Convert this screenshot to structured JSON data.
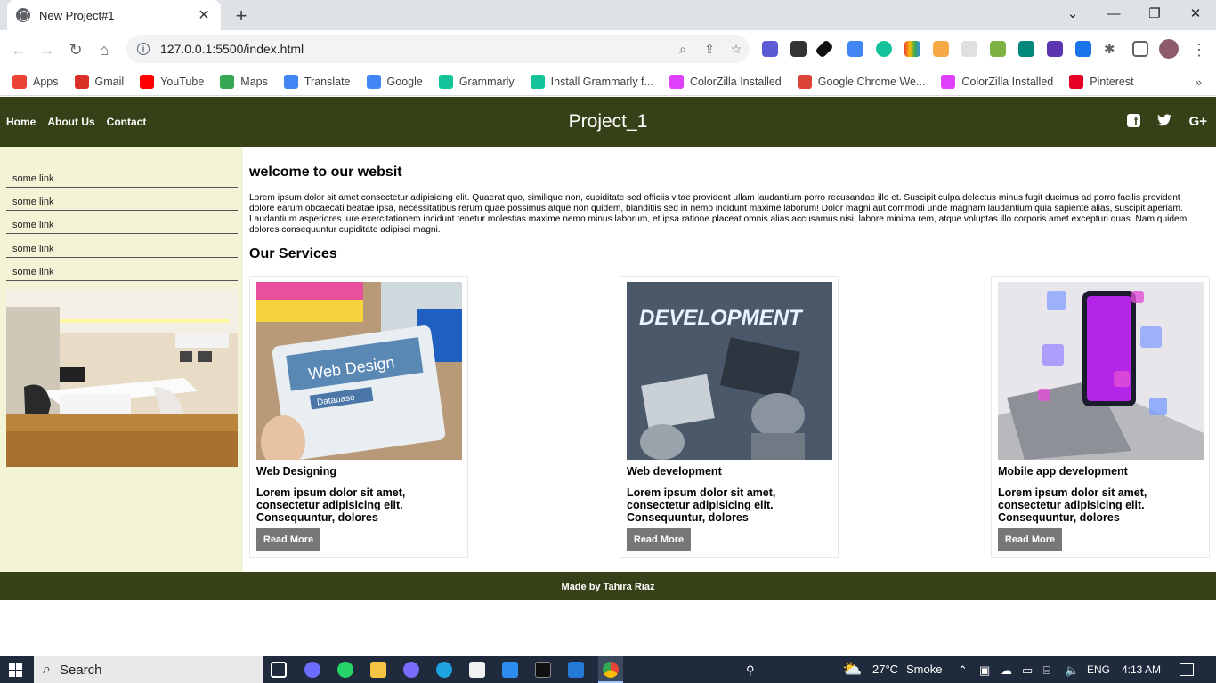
{
  "browser": {
    "tab_title": "New Project#1",
    "tab_close": "✕",
    "new_tab": "+",
    "url": "127.0.0.1:5500/index.html",
    "bookmarks": [
      {
        "label": "Apps",
        "icon": "apps-grid-icon",
        "color": "#ea4335"
      },
      {
        "label": "Gmail",
        "icon": "gmail-icon",
        "color": "#d93025"
      },
      {
        "label": "YouTube",
        "icon": "youtube-icon",
        "color": "#ff0000"
      },
      {
        "label": "Maps",
        "icon": "maps-pin-icon",
        "color": "#34a853"
      },
      {
        "label": "Translate",
        "icon": "translate-icon",
        "color": "#4285f4"
      },
      {
        "label": "Google",
        "icon": "google-icon",
        "color": "#4285f4"
      },
      {
        "label": "Grammarly",
        "icon": "grammarly-icon",
        "color": "#15c39a"
      },
      {
        "label": "Install Grammarly f...",
        "icon": "grammarly-icon",
        "color": "#15c39a"
      },
      {
        "label": "ColorZilla Installed",
        "icon": "colorzilla-icon",
        "color": "#e040fb"
      },
      {
        "label": "Google Chrome We...",
        "icon": "chrome-icon",
        "color": "#db4437"
      },
      {
        "label": "ColorZilla Installed",
        "icon": "colorzilla-icon",
        "color": "#e040fb"
      },
      {
        "label": "Pinterest",
        "icon": "pinterest-icon",
        "color": "#e60023"
      }
    ]
  },
  "site": {
    "nav": [
      "Home",
      "About Us",
      "Contact"
    ],
    "title": "Project_1",
    "social": {
      "facebook": "f",
      "twitter": "🐦",
      "google_plus": "G+"
    },
    "sidebar_links": [
      "some link",
      "some link",
      "some link",
      "some link",
      "some link"
    ],
    "welcome": "welcome to our websit",
    "intro": "Lorem ipsum dolor sit amet consectetur adipisicing elit. Quaerat quo, similique non, cupiditate sed officiis vitae provident ullam laudantium porro recusandae illo et. Suscipit culpa delectus minus fugit ducimus ad porro facilis provident dolore earum obcaecati beatae ipsa, necessitatibus rerum quae possimus atque non quidem, blanditiis sed in nemo incidunt maxime laborum! Dolor magni aut commodi unde magnam laudantium quia sapiente alias, suscipit aperiam. Laudantium asperiores iure exercitationem incidunt tenetur molestias maxime nemo minus laborum, et ipsa ratione placeat omnis alias accusamus nisi, labore minima rem, atque voluptas illo corporis amet excepturi quas. Nam quidem dolores consequuntur cupiditate adipisci magni.",
    "services_heading": "Our Services",
    "services": [
      {
        "title": "Web Designing",
        "text": "Lorem ipsum dolor sit amet, consectetur adipisicing elit. Consequuntur, dolores",
        "button": "Read More",
        "image_text": "Web Design",
        "image_sub": "Database"
      },
      {
        "title": "Web development",
        "text": "Lorem ipsum dolor sit amet, consectetur adipisicing elit. Consequuntur, dolores",
        "button": "Read More",
        "image_text": "DEVELOPMENT"
      },
      {
        "title": "Mobile app development",
        "text": "Lorem ipsum dolor sit amet, consectetur adipisicing elit. Consequuntur, dolores",
        "button": "Read More"
      }
    ],
    "footer": "Made by Tahira Riaz"
  },
  "taskbar": {
    "search": "Search",
    "temperature": "27°C",
    "weather": "Smoke",
    "language": "ENG",
    "time": "4:13 AM"
  },
  "colors": {
    "header": "#374118",
    "sidebar": "#f3f4d6",
    "button": "#777777"
  }
}
